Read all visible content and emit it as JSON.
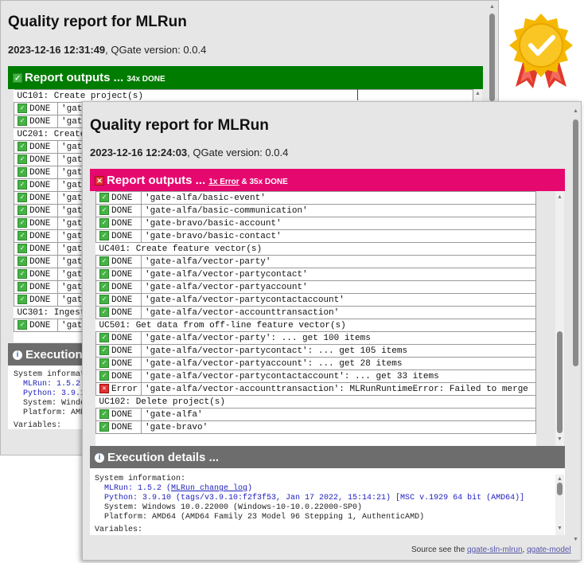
{
  "back": {
    "title": "Quality report for MLRun",
    "timestamp": "2023-12-16 12:31:49",
    "version": ", QGate version: 0.0.4",
    "outputs_title": "Report outputs ...",
    "outputs_summary": "34x DONE",
    "rows": [
      {
        "kind": "uc",
        "text": "UC101: Create project(s)"
      },
      {
        "kind": "done",
        "status": "DONE",
        "text": "'gate"
      },
      {
        "kind": "done",
        "status": "DONE",
        "text": "'gate"
      },
      {
        "kind": "uc",
        "text": "UC201: Create"
      },
      {
        "kind": "done",
        "status": "DONE",
        "text": "'gate"
      },
      {
        "kind": "done",
        "status": "DONE",
        "text": "'gate"
      },
      {
        "kind": "done",
        "status": "DONE",
        "text": "'gate"
      },
      {
        "kind": "done",
        "status": "DONE",
        "text": "'gate"
      },
      {
        "kind": "done",
        "status": "DONE",
        "text": "'gate"
      },
      {
        "kind": "done",
        "status": "DONE",
        "text": "'gate"
      },
      {
        "kind": "done",
        "status": "DONE",
        "text": "'gate"
      },
      {
        "kind": "done",
        "status": "DONE",
        "text": "'gate"
      },
      {
        "kind": "done",
        "status": "DONE",
        "text": "'gate"
      },
      {
        "kind": "done",
        "status": "DONE",
        "text": "'gate"
      },
      {
        "kind": "done",
        "status": "DONE",
        "text": "'gate"
      },
      {
        "kind": "done",
        "status": "DONE",
        "text": "'gate"
      },
      {
        "kind": "done",
        "status": "DONE",
        "text": "'gate"
      },
      {
        "kind": "uc",
        "text": "UC301: Ingest"
      },
      {
        "kind": "done",
        "status": "DONE",
        "text": "'gate"
      }
    ],
    "execution_title": "Execution d",
    "details": {
      "system_info": "System informati",
      "mlrun": "MLRun: 1.5.2",
      "python": "Python: 3.9.10",
      "system": "System: Windo",
      "platform": "Platform: AMD6",
      "variables": "Variables:"
    }
  },
  "front": {
    "title": "Quality report for MLRun",
    "timestamp": "2023-12-16 12:24:03",
    "version": ", QGate version: 0.0.4",
    "outputs_title": "Report outputs ...",
    "outputs_summary_link": "1x Error",
    "outputs_summary_rest": " & 35x DONE",
    "rows": [
      {
        "kind": "done",
        "status": "DONE",
        "text": "'gate-alfa/basic-event'"
      },
      {
        "kind": "done",
        "status": "DONE",
        "text": "'gate-alfa/basic-communication'"
      },
      {
        "kind": "done",
        "status": "DONE",
        "text": "'gate-bravo/basic-account'"
      },
      {
        "kind": "done",
        "status": "DONE",
        "text": "'gate-bravo/basic-contact'"
      },
      {
        "kind": "uc",
        "text": "UC401: Create feature vector(s)"
      },
      {
        "kind": "done",
        "status": "DONE",
        "text": "'gate-alfa/vector-party'"
      },
      {
        "kind": "done",
        "status": "DONE",
        "text": "'gate-alfa/vector-partycontact'"
      },
      {
        "kind": "done",
        "status": "DONE",
        "text": "'gate-alfa/vector-partyaccount'"
      },
      {
        "kind": "done",
        "status": "DONE",
        "text": "'gate-alfa/vector-partycontactaccount'"
      },
      {
        "kind": "done",
        "status": "DONE",
        "text": "'gate-alfa/vector-accounttransaction'"
      },
      {
        "kind": "uc",
        "text": "UC501: Get data from off-line feature vector(s)"
      },
      {
        "kind": "done",
        "status": "DONE",
        "text": "'gate-alfa/vector-party': ... get 100 items"
      },
      {
        "kind": "done",
        "status": "DONE",
        "text": "'gate-alfa/vector-partycontact': ... get 105 items"
      },
      {
        "kind": "done",
        "status": "DONE",
        "text": "'gate-alfa/vector-partyaccount': ... get 28 items"
      },
      {
        "kind": "done",
        "status": "DONE",
        "text": "'gate-alfa/vector-partycontactaccount': ... get 33 items"
      },
      {
        "kind": "error",
        "status": "Error",
        "text": "'gate-alfa/vector-accounttransaction': MLRunRuntimeError: Failed to merge"
      },
      {
        "kind": "uc",
        "text": "UC102: Delete project(s)"
      },
      {
        "kind": "done",
        "status": "DONE",
        "text": "'gate-alfa'"
      },
      {
        "kind": "done",
        "status": "DONE",
        "text": "'gate-bravo'"
      }
    ],
    "execution_title": "Execution details ...",
    "details": {
      "system_info": "System information:",
      "mlrun_label": "MLRun: 1.5.2 (",
      "mlrun_link": "MLRun change log",
      "mlrun_close": ")",
      "python": "Python: 3.9.10 (tags/v3.9.10:f2f3f53, Jan 17 2022, 15:14:21) [MSC v.1929 64 bit (AMD64)]",
      "system": "System: Windows 10.0.22000 (Windows-10-10.0.22000-SP0)",
      "platform": "Platform: AMD64 (AMD64 Family 23 Model 96 Stepping 1, AuthenticAMD)",
      "variables": "Variables:"
    },
    "footer": {
      "prefix": "Source see the ",
      "link1": "qgate-sln-mlrun",
      "sep": ", ",
      "link2": "qgate-model"
    }
  },
  "colors": {
    "ok_bar": "#007c00",
    "error_bar": "#e5086f",
    "section_bar": "#6d6d6d",
    "badge_gold": "#f5b800",
    "badge_red": "#e03a2a"
  },
  "icons": {
    "done": "check-icon",
    "error": "error-x-icon",
    "info": "info-icon",
    "badge": "quality-badge-icon"
  }
}
